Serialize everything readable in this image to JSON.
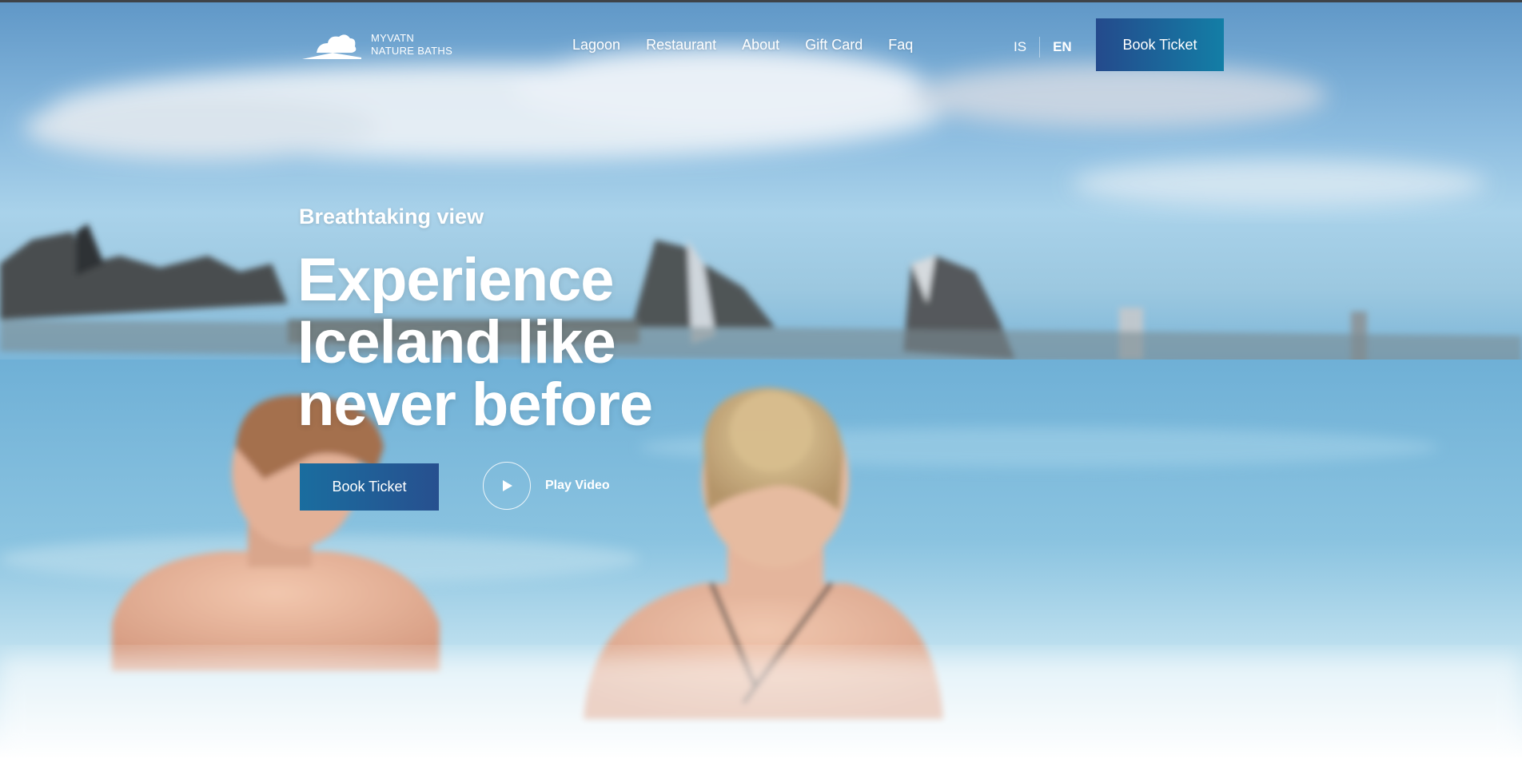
{
  "logo": {
    "line1": "MYVATN",
    "line2": "NATURE BATHS"
  },
  "nav": {
    "items": [
      {
        "label": "Lagoon"
      },
      {
        "label": "Restaurant"
      },
      {
        "label": "About"
      },
      {
        "label": "Gift Card"
      },
      {
        "label": "Faq"
      }
    ]
  },
  "languages": {
    "options": [
      "IS",
      "EN"
    ],
    "selected": "EN"
  },
  "header": {
    "book_label": "Book Ticket"
  },
  "hero": {
    "eyebrow": "Breathtaking view",
    "headline_lines": [
      "Experience",
      "Iceland like",
      "never before"
    ],
    "book_label": "Book Ticket",
    "play_label": "Play Video"
  },
  "colors": {
    "button_gradient_start": "#244a8c",
    "button_gradient_end": "#137ea6",
    "text": "#ffffff"
  }
}
